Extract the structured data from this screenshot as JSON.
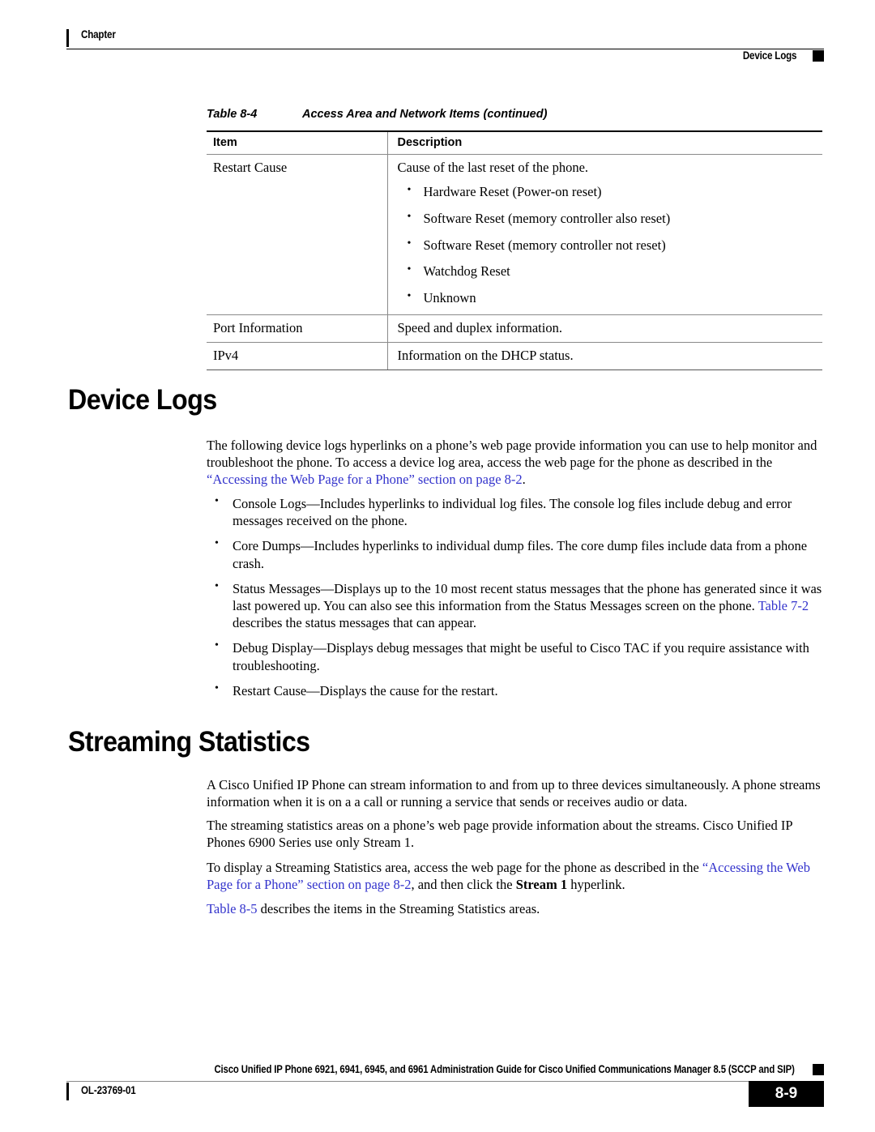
{
  "header": {
    "chapter_label": "Chapter",
    "section_label": "Device Logs"
  },
  "table": {
    "caption_number": "Table 8-4",
    "caption_title": "Access Area and Network Items (continued)",
    "columns": [
      "Item",
      "Description"
    ],
    "rows": [
      {
        "item": "Restart Cause",
        "description": "Cause of the last reset of the phone.",
        "bullets": [
          "Hardware Reset (Power-on reset)",
          "Software Reset (memory controller also reset)",
          "Software Reset (memory controller not reset)",
          "Watchdog Reset",
          "Unknown"
        ]
      },
      {
        "item": "Port Information",
        "description": "Speed and duplex information.",
        "bullets": []
      },
      {
        "item": "IPv4",
        "description": "Information on the DHCP status.",
        "bullets": []
      }
    ]
  },
  "device_logs": {
    "heading": "Device Logs",
    "intro_part1": "The following device logs hyperlinks on a phone’s web page provide information you can use to help monitor and troubleshoot the phone. To access a device log area, access the web page for the phone as described in the ",
    "intro_link": "“Accessing the Web Page for a Phone” section on page 8-2",
    "intro_part2": ".",
    "bullets": [
      {
        "text_before": "Console Logs—Includes hyperlinks to individual log files. The console log files include debug and error messages received on the phone.",
        "link": "",
        "text_after": ""
      },
      {
        "text_before": "Core Dumps—Includes hyperlinks to individual dump files. The core dump files include data from a phone crash.",
        "link": "",
        "text_after": ""
      },
      {
        "text_before": "Status Messages—Displays up to the 10 most recent status messages that the phone has generated since it was last powered up. You can also see this information from the Status Messages screen on the phone. ",
        "link": "Table 7-2",
        "text_after": " describes the status messages that can appear."
      },
      {
        "text_before": "Debug Display—Displays debug messages that might be useful to Cisco TAC if you require assistance with troubleshooting.",
        "link": "",
        "text_after": ""
      },
      {
        "text_before": "Restart Cause—Displays the cause for the restart.",
        "link": "",
        "text_after": ""
      }
    ]
  },
  "streaming_statistics": {
    "heading": "Streaming Statistics",
    "para1": "A Cisco Unified IP Phone can stream information to and from up to three devices simultaneously. A phone streams information when it is on a a call or running a service that sends or receives audio or data.",
    "para2": "The streaming statistics areas on a phone’s web page provide information about the streams. Cisco Unified IP Phones 6900 Series use only Stream 1.",
    "para3_part1": "To display a Streaming Statistics area, access the web page for the phone as described in the ",
    "para3_link": "“Accessing the Web Page for a Phone” section on page 8-2",
    "para3_part2": ", and then click the ",
    "para3_bold": "Stream 1",
    "para3_part3": " hyperlink.",
    "para4_link": "Table 8-5",
    "para4_text": " describes the items in the Streaming Statistics areas."
  },
  "footer": {
    "guide_title": "Cisco Unified IP Phone 6921, 6941, 6945, and 6961 Administration Guide for Cisco Unified Communications Manager 8.5 (SCCP and SIP)",
    "doc_id": "OL-23769-01",
    "page_number": "8-9"
  },
  "colors": {
    "link": "#3333cc",
    "text": "#000000",
    "rule": "#8a8a8a"
  }
}
